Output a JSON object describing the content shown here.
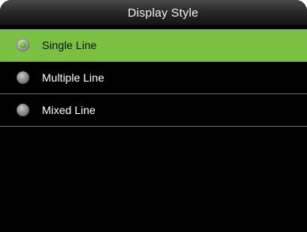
{
  "header": {
    "title": "Display Style"
  },
  "options": [
    {
      "label": "Single Line",
      "selected": true
    },
    {
      "label": "Multiple Line",
      "selected": false
    },
    {
      "label": "Mixed Line",
      "selected": false
    }
  ],
  "colors": {
    "background": "#000000",
    "selected_row": "#7ac143",
    "divider": "#6a6a6a",
    "text": "#ffffff"
  },
  "icons": {
    "radio_selected": "radio-selected-icon",
    "radio_unselected": "radio-unselected-icon"
  }
}
